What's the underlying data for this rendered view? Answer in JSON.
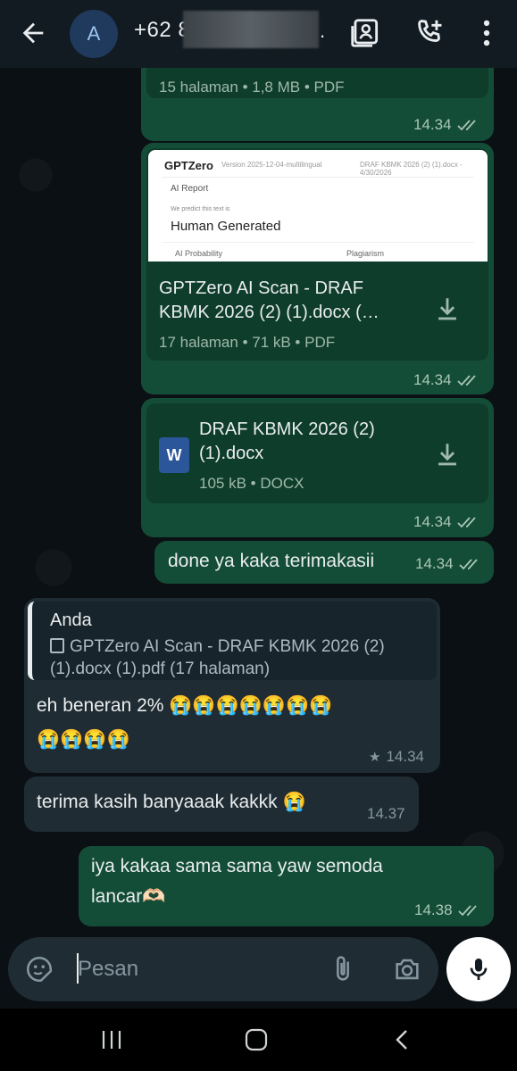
{
  "header": {
    "avatar_letter": "A",
    "contact_name_visible": "+62 8",
    "contact_name_suffix": "."
  },
  "messages": {
    "pdf1": {
      "pages_size_type": "15 halaman • 1,8 MB • PDF",
      "time": "14.34"
    },
    "pdf2": {
      "preview": {
        "logo": "GPTZero",
        "version": "Version 2025-12-04-multilingual",
        "file": "DRAF KBMK 2026 (2) (1).docx - 4/30/2026",
        "report": "AI Report",
        "predict": "We predict this text is",
        "result": "Human Generated",
        "ai_probability": "AI Probability",
        "plagiarism": "Plagiarism"
      },
      "title_line1": "GPTZero AI Scan - DRAF",
      "title_line2": "KBMK 2026 (2) (1).docx (…",
      "meta": "17 halaman • 71 kB • PDF",
      "time": "14.34"
    },
    "docx": {
      "icon_letter": "W",
      "title_line1": "DRAF KBMK 2026 (2)",
      "title_line2": "(1).docx",
      "meta": "105 kB • DOCX",
      "time": "14.34"
    },
    "done": {
      "text": "done ya kaka terimakasii",
      "time": "14.34"
    },
    "reply": {
      "quote_author": "Anda",
      "quote_line1": "GPTZero AI Scan - DRAF KBMK 2026 (2)",
      "quote_line2": "(1).docx (1).pdf (17 halaman)",
      "text_line1": "eh beneran 2% 😭😭😭😭😭😭😭",
      "text_line2": "😭😭😭😭",
      "time": "14.34"
    },
    "thanks": {
      "text": "terima kasih banyaaak kakkk 😭",
      "time": "14.37"
    },
    "reply_out": {
      "text_line1": "iya kakaa sama sama yaw semoda",
      "text_line2": "lancar🫶🏻",
      "time": "14.38"
    }
  },
  "input": {
    "placeholder": "Pesan"
  },
  "colors": {
    "outgoing_bubble": "#144d37",
    "incoming_bubble": "#1f2c33",
    "background": "#0b1014"
  }
}
